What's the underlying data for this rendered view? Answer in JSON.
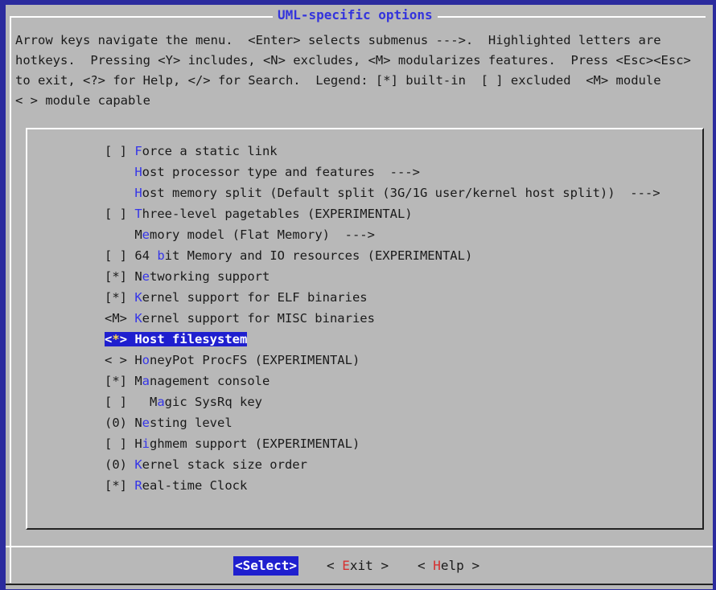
{
  "dialog": {
    "title": "UML-specific options",
    "help_lines": [
      "Arrow keys navigate the menu.  <Enter> selects submenus --->.  Highlighted letters are",
      "hotkeys.  Pressing <Y> includes, <N> excludes, <M> modularizes features.  Press <Esc><Esc>",
      "to exit, <?> for Help, </> for Search.  Legend: [*] built-in  [ ] excluded  <M> module",
      "< > module capable"
    ]
  },
  "menu": {
    "items": [
      {
        "prefix": "[ ] ",
        "hot": "F",
        "rest": "orce a static link"
      },
      {
        "prefix": "    ",
        "hot": "H",
        "rest": "ost processor type and features  --->"
      },
      {
        "prefix": "    ",
        "hot": "H",
        "rest": "ost memory split (Default split (3G/1G user/kernel host split))  --->"
      },
      {
        "prefix": "[ ] ",
        "hot": "T",
        "rest": "hree-level pagetables (EXPERIMENTAL)"
      },
      {
        "prefix": "    M",
        "hot": "e",
        "rest": "mory model (Flat Memory)  --->"
      },
      {
        "prefix": "[ ] 64 ",
        "hot": "b",
        "rest": "it Memory and IO resources (EXPERIMENTAL)"
      },
      {
        "prefix": "[*] N",
        "hot": "e",
        "rest": "tworking support"
      },
      {
        "prefix": "[*] ",
        "hot": "K",
        "rest": "ernel support for ELF binaries"
      },
      {
        "prefix": "<M> ",
        "hot": "K",
        "rest": "ernel support for MISC binaries"
      },
      {
        "prefix": "<",
        "hot": "*",
        "rest": "> Host filesystem",
        "selected": true
      },
      {
        "prefix": "< > H",
        "hot": "o",
        "rest": "neyPot ProcFS (EXPERIMENTAL)"
      },
      {
        "prefix": "[*] M",
        "hot": "a",
        "rest": "nagement console"
      },
      {
        "prefix": "[ ]   M",
        "hot": "a",
        "rest": "gic SysRq key"
      },
      {
        "prefix": "(0) N",
        "hot": "e",
        "rest": "sting level"
      },
      {
        "prefix": "[ ] H",
        "hot": "i",
        "rest": "ghmem support (EXPERIMENTAL)"
      },
      {
        "prefix": "(0) ",
        "hot": "K",
        "rest": "ernel stack size order"
      },
      {
        "prefix": "[*] ",
        "hot": "R",
        "rest": "eal-time Clock"
      }
    ]
  },
  "buttons": {
    "select": "<Select>",
    "exit": {
      "pre": "< ",
      "hot": "E",
      "rest": "xit >"
    },
    "help": {
      "pre": "< ",
      "hot": "H",
      "rest": "elp >"
    }
  },
  "colors": {
    "background": "#2b2b9e",
    "dialog": "#b8b8b8",
    "highlight": "#1f1fcf",
    "hotkey": "#3535e8",
    "button_hotkey": "#d63030"
  }
}
